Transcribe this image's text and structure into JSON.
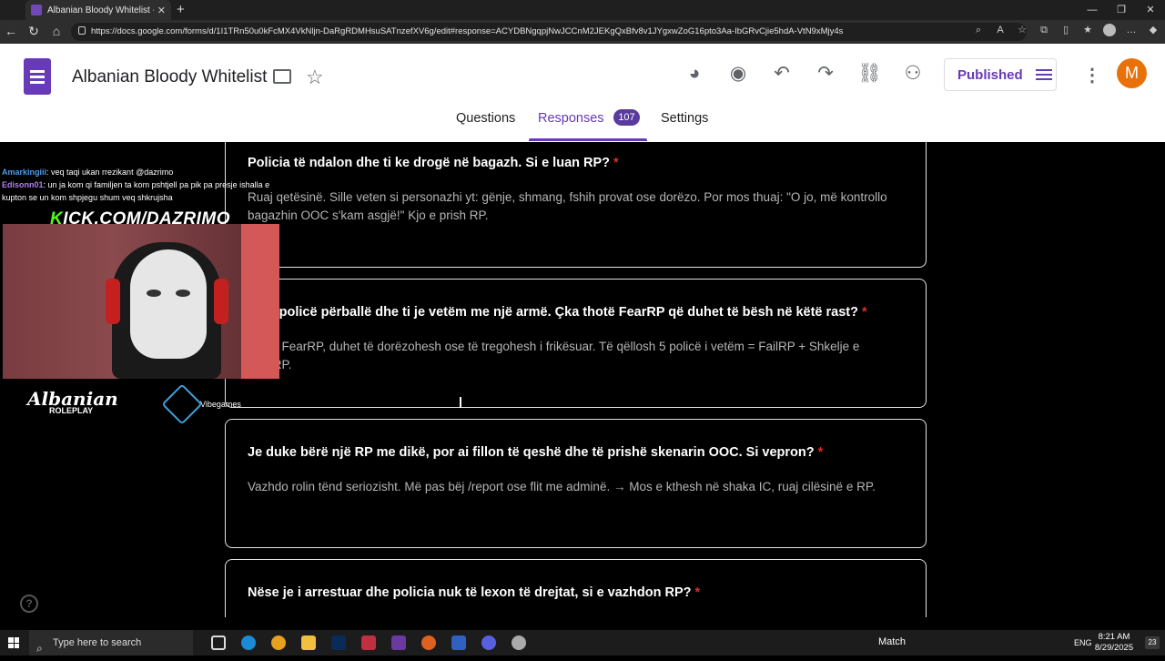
{
  "browser": {
    "tab_title": "Albanian Bloody Whitelist - Goog",
    "url": "https://docs.google.com/forms/d/1I1TRn50u0kFcMX4VkNljn-DaRgRDMHsuSATnzefXV6g/edit#response=ACYDBNgqpjNwJCCnM2JEKgQxBfv8v1JYgxwZoG16pto3Aa-IbGRvCjie5hdA-VtN9xMjy4s"
  },
  "form": {
    "title": "Albanian Bloody Whitelist",
    "publish_label": "Published",
    "avatar_letter": "M",
    "tabs": {
      "questions": "Questions",
      "responses": "Responses",
      "responses_count": "107",
      "settings": "Settings"
    }
  },
  "questions": [
    {
      "text": "Policia të ndalon dhe ti ke drogë në bagazh. Si e luan RP?",
      "answer": "Ruaj qetësinë. Sille veten si personazhi yt: gënje, shmang, fshih provat ose dorëzo. Por mos thuaj:  \"O jo, më kontrollo bagazhin OOC s'kam asgjë!\" Kjo e prish RP."
    },
    {
      "text": "Ke 5 policë përballë dhe ti je vetëm me një armë. Çka thotë FearRP që duhet të bësh në këtë rast?",
      "answer": "Sipas FearRP, duhet të dorëzohesh ose të tregohesh i frikësuar. Të qëllosh 5 policë i vetëm = FailRP + Shkelje e FearRP."
    },
    {
      "text": "Je duke bërë një RP me dikë, por ai fillon të qeshë dhe të prishë skenarin OOC. Si vepron?",
      "answer": "Vazhdo rolin tënd seriozisht. Më pas bëj /report ose flit me adminë. → Mos e kthesh në shaka IC, ruaj cilësinë e RP."
    },
    {
      "text": "Nëse je i arrestuar dhe policia nuk të lexon të drejtat, si e vazhdon RP?",
      "answer": ""
    }
  ],
  "required_mark": "*",
  "stream": {
    "chat": [
      {
        "user": "Amarkingiii",
        "message": ": veq taqi ukan rrezikant @dazrimo"
      },
      {
        "user": "Edisonn01",
        "message": ": un ja kom qi familjen ta kom pshtjell pa pik pa presje ishalla e kupton se un kom shpjegu shum veq shkrujsha"
      }
    ],
    "kick_prefix": "K",
    "kick_rest": "ICK.COM/DAZRIMO",
    "logo_left": "Albanian",
    "logo_left_sub": "ROLEPLAY",
    "logo_right": "Vibegames"
  },
  "taskbar": {
    "search_placeholder": "Type here to search",
    "weather": "Match",
    "language": "ENG",
    "time": "8:21 AM",
    "date": "8/29/2025",
    "notifications": "23"
  },
  "colors": {
    "forms_purple": "#673ab7",
    "required_red": "#d93025",
    "kick_green": "#53fc18",
    "avatar_orange": "#e8710a"
  }
}
